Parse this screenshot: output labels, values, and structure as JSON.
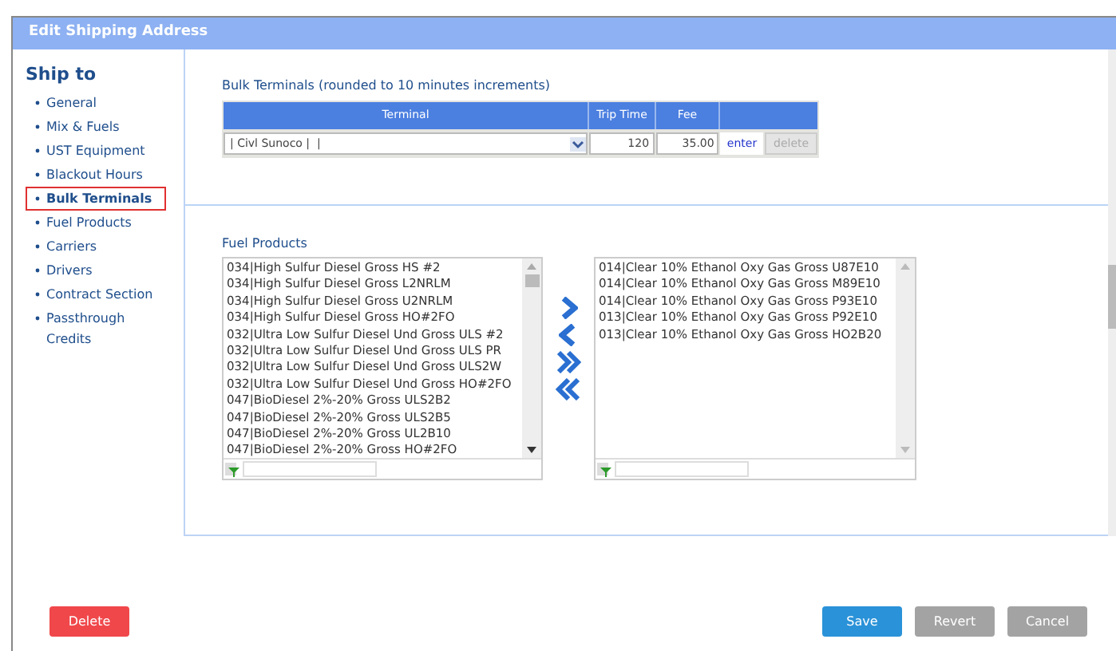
{
  "window": {
    "title": "Edit Shipping Address"
  },
  "sidebar": {
    "heading": "Ship to",
    "items": [
      {
        "label": "General",
        "selected": false
      },
      {
        "label": "Mix & Fuels",
        "selected": false
      },
      {
        "label": "UST Equipment",
        "selected": false
      },
      {
        "label": "Blackout Hours",
        "selected": false
      },
      {
        "label": "Bulk Terminals",
        "selected": true
      },
      {
        "label": "Fuel Products",
        "selected": false
      },
      {
        "label": "Carriers",
        "selected": false
      },
      {
        "label": "Drivers",
        "selected": false
      },
      {
        "label": "Contract Section",
        "selected": false
      },
      {
        "label": "Passthrough Credits",
        "selected": false
      }
    ]
  },
  "bulk_terminals": {
    "title": "Bulk Terminals (rounded to 10 minutes increments)",
    "columns": [
      "Terminal",
      "Trip Time",
      "Fee"
    ],
    "row": {
      "terminal": "| Civl Sunoco |  |",
      "trip_time": "120",
      "fee": "35.00",
      "enter": "enter",
      "delete": {
        "label": "delete",
        "disabled": true
      }
    }
  },
  "fuel_products": {
    "title": "Fuel Products",
    "available": [
      "034|High Sulfur Diesel Gross HS #2",
      "034|High Sulfur Diesel Gross L2NRLM",
      "034|High Sulfur Diesel Gross U2NRLM",
      "034|High Sulfur Diesel Gross HO#2FO",
      "032|Ultra Low Sulfur Diesel Und Gross ULS #2",
      "032|Ultra Low Sulfur Diesel Und Gross ULS PR",
      "032|Ultra Low Sulfur Diesel Und Gross ULS2W",
      "032|Ultra Low Sulfur Diesel Und Gross HO#2FO",
      "047|BioDiesel 2%-20% Gross ULS2B2",
      "047|BioDiesel 2%-20% Gross ULS2B5",
      "047|BioDiesel 2%-20% Gross UL2B10",
      "047|BioDiesel 2%-20% Gross HO#2FO"
    ],
    "chosen": [
      "014|Clear 10% Ethanol Oxy Gas Gross U87E10",
      "014|Clear 10% Ethanol Oxy Gas Gross M89E10",
      "014|Clear 10% Ethanol Oxy Gas Gross P93E10",
      "013|Clear 10% Ethanol Oxy Gas Gross P92E10",
      "013|Clear 10% Ethanol Oxy Gas Gross HO2B20"
    ]
  },
  "buttons": [
    {
      "label": "Delete",
      "kind": "danger"
    },
    {
      "label": "Save",
      "kind": "primary"
    },
    {
      "label": "Revert",
      "kind": "secondary"
    },
    {
      "label": "Cancel",
      "kind": "secondary"
    }
  ]
}
